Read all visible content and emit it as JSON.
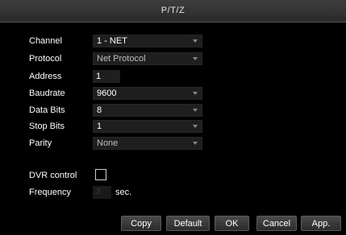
{
  "window": {
    "title": "P/T/Z"
  },
  "fields": {
    "channel": {
      "label": "Channel",
      "value": "1 - NET"
    },
    "protocol": {
      "label": "Protocol",
      "value": "Net Protocol"
    },
    "address": {
      "label": "Address",
      "value": "1"
    },
    "baudrate": {
      "label": "Baudrate",
      "value": "9600"
    },
    "data_bits": {
      "label": "Data Bits",
      "value": "8"
    },
    "stop_bits": {
      "label": "Stop Bits",
      "value": "1"
    },
    "parity": {
      "label": "Parity",
      "value": "None"
    },
    "dvr_control": {
      "label": "DVR control",
      "checked": false
    },
    "frequency": {
      "label": "Frequency",
      "value": "3",
      "unit": "sec."
    }
  },
  "buttons": {
    "copy": "Copy",
    "default": "Default",
    "ok": "OK",
    "cancel": "Cancel",
    "apply": "App."
  },
  "icons": {
    "dropdown": "chevron-down-icon"
  },
  "colors": {
    "background": "#000000",
    "field": "#1f1f1f",
    "titlebar": "#333333"
  }
}
